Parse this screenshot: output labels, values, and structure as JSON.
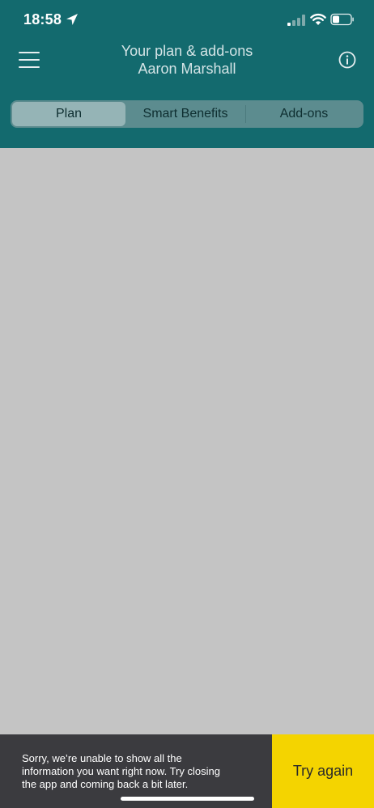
{
  "status_bar": {
    "time": "18:58"
  },
  "header": {
    "title": "Your plan & add-ons",
    "subtitle": "Aaron Marshall"
  },
  "tabs": [
    {
      "label": "Plan",
      "selected": true
    },
    {
      "label": "Smart Benefits",
      "selected": false
    },
    {
      "label": "Add-ons",
      "selected": false
    }
  ],
  "error_banner": {
    "message": "Sorry, we’re unable to show all the\ninformation you want right now. Try closing\nthe app and coming back a bit later.",
    "action_label": "Try again"
  },
  "colors": {
    "header_background": "#136a6e",
    "content_background": "#c4c4c4",
    "banner_background": "#3b3b3f",
    "action_background": "#f4d400"
  }
}
